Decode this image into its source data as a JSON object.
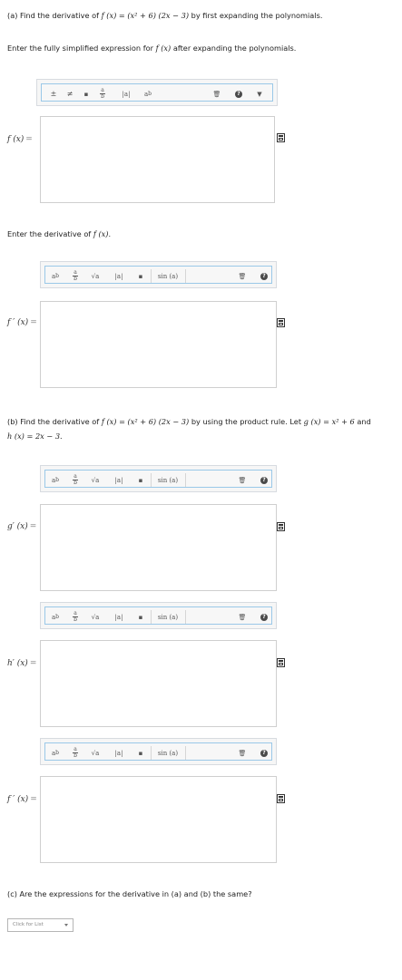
{
  "part_a": {
    "prompt_prefix": "(a) Find the derivative of",
    "prompt_suffix": "by first expanding the polynomials.",
    "instruction_expand": "Enter the fully simplified expression for",
    "instruction_expand_suffix": "after expanding the polynomials.",
    "instruction_derivative": "Enter the derivative of"
  },
  "part_b": {
    "prompt_prefix": "(b) Find the derivative of",
    "prompt_middle": "by using the product rule. Let",
    "prompt_and": "and"
  },
  "part_c": {
    "prompt": "(c) Are the expressions for the derivative in (a) and (b) the same?",
    "select_placeholder": "Click for List"
  },
  "labels": {
    "f": "f (x)",
    "f_prime": "f ′ (x)",
    "g_prime": "g′ (x)",
    "h_prime": "h′ (x)",
    "equals": "="
  },
  "math": {
    "fx": "f (x) =",
    "expr": "(x² + 6) (2x − 3)",
    "gx": "g (x) = x² + 6",
    "hx": "h (x) = 2x − 3.",
    "fx_short": "f (x)"
  },
  "toolbar": {
    "sin_label": "sin (a)",
    "abs_label": "|a|"
  },
  "colors": {
    "toolbar_border": "#9ac8e8",
    "answer_border": "#cfcfcf"
  }
}
